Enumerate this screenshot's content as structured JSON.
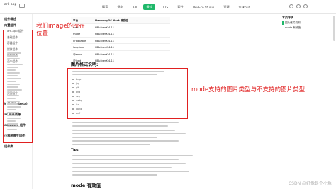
{
  "topbar": {
    "app_name": "ark-app",
    "nav": [
      "搜索",
      "指南",
      "API",
      "最佳",
      "UITS",
      "套件",
      "DevEco Studio",
      "资源",
      "SDKhub"
    ],
    "active_nav_index": 3,
    "accent": "#1fb86a"
  },
  "sidebar": {
    "items": [
      {
        "label": "组件概述",
        "kind": "section"
      },
      {
        "label": "内置组件",
        "kind": "section"
      },
      {
        "label": "ark-app 组件",
        "kind": "sub"
      },
      {
        "label": "基础组件",
        "kind": "sub"
      },
      {
        "label": "容器组件",
        "kind": "sub"
      },
      {
        "label": "媒体组件",
        "kind": "sub"
      },
      {
        "label": "绘制组件",
        "kind": "sub"
      },
      {
        "label": "画布组件",
        "kind": "sub"
      },
      {
        "label": "image",
        "kind": "hl"
      },
      {
        "label": "页面组件",
        "kind": "sub"
      },
      {
        "label": "扩展组件 (beta)",
        "kind": "section"
      },
      {
        "label": "ar 设计资源",
        "kind": "section"
      },
      {
        "label": "datacom 组件",
        "kind": "section"
      },
      {
        "label": "小程序原生组件",
        "kind": "section"
      },
      {
        "label": "组件库",
        "kind": "section"
      }
    ]
  },
  "annotations": {
    "left": "我们image的所在位置",
    "mid": "mode支持的图片类型与不支持的图片类型"
  },
  "table": {
    "headers": [
      "平台",
      "HarmonyOS Next 兼容性"
    ],
    "rows": [
      [
        "web",
        "HBuilderX 4.11"
      ],
      [
        "mode",
        "HBuilderX 4.11"
      ],
      [
        "draggable",
        "HBuilderX 4.11"
      ],
      [
        "lazy-load",
        "HBuilderX 4.11"
      ],
      [
        "@error",
        "HBuilderX 4.11"
      ],
      [
        "@load",
        "HBuilderX 4.11"
      ]
    ]
  },
  "doc": {
    "title": "图片格式说明:",
    "formats": [
      "bmp",
      "jpg",
      "gif",
      "png",
      "svg",
      "webp",
      "ico",
      "apng",
      "avif"
    ],
    "tips": "Tips",
    "mode_title": "mode 有效值"
  },
  "toc": {
    "title": "本页导读",
    "items": [
      "图片格式说明",
      "mode 有效值"
    ]
  },
  "watermark": "CSDN @好像是个小鱼"
}
